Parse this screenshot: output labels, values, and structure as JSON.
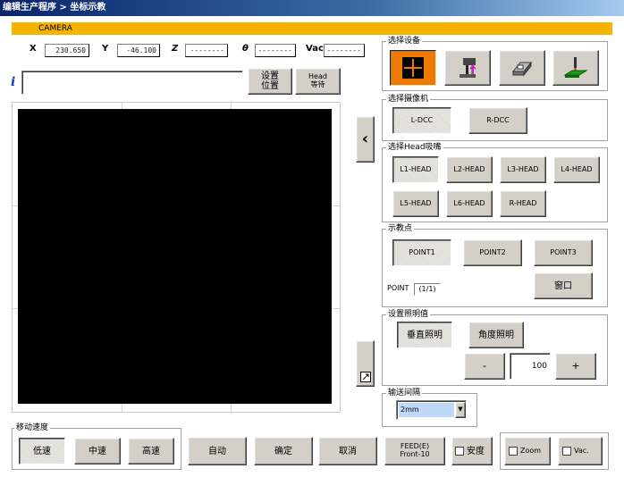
{
  "window": {
    "title": "编辑生产程序 > 坐标示教"
  },
  "camera_bar": {
    "label": "CAMERA"
  },
  "coords": {
    "x_label": "X",
    "x_value": "230.650",
    "y_label": "Y",
    "y_value": "-46.100",
    "z_label": "Z",
    "z_value": "--------",
    "theta_label": "θ",
    "theta_value": "--------",
    "vac_label": "Vac",
    "vac_value": "--------"
  },
  "info": {
    "icon": "info-icon",
    "value": ""
  },
  "top_buttons": {
    "set_position": "设置\n位置",
    "head_wait": "Head\n等待"
  },
  "side_buttons": {
    "collapse": "‹"
  },
  "device_group": {
    "label": "选择设备"
  },
  "camera_group": {
    "label": "选择摄像机",
    "buttons": [
      "L-DCC",
      "R-DCC"
    ]
  },
  "head_group": {
    "label": "选择Head吸嘴",
    "buttons": [
      "L1-HEAD",
      "L2-HEAD",
      "L3-HEAD",
      "L4-HEAD",
      "L5-HEAD",
      "L6-HEAD",
      "R-HEAD"
    ]
  },
  "teach_group": {
    "label": "示教点",
    "buttons": [
      "POINT1",
      "POINT2",
      "POINT3"
    ],
    "point_label": "POINT",
    "point_value": "(1/1)",
    "window_button": "窗口"
  },
  "light_group": {
    "label": "设置照明值",
    "vertical": "垂直照明",
    "angle": "角度照明",
    "minus": "-",
    "value": "100",
    "plus": "+"
  },
  "transport_group": {
    "label": "输送间隔",
    "selected": "2mm"
  },
  "speed_group": {
    "label": "移动速度",
    "buttons": [
      "低速",
      "中速",
      "高速"
    ]
  },
  "bottom_buttons": {
    "auto": "自动",
    "confirm": "确定",
    "cancel": "取消",
    "feed": "FEED(E)\nFront-10"
  },
  "checks": {
    "precise": "安度",
    "zoom": "Zoom",
    "vac": "Vac."
  }
}
